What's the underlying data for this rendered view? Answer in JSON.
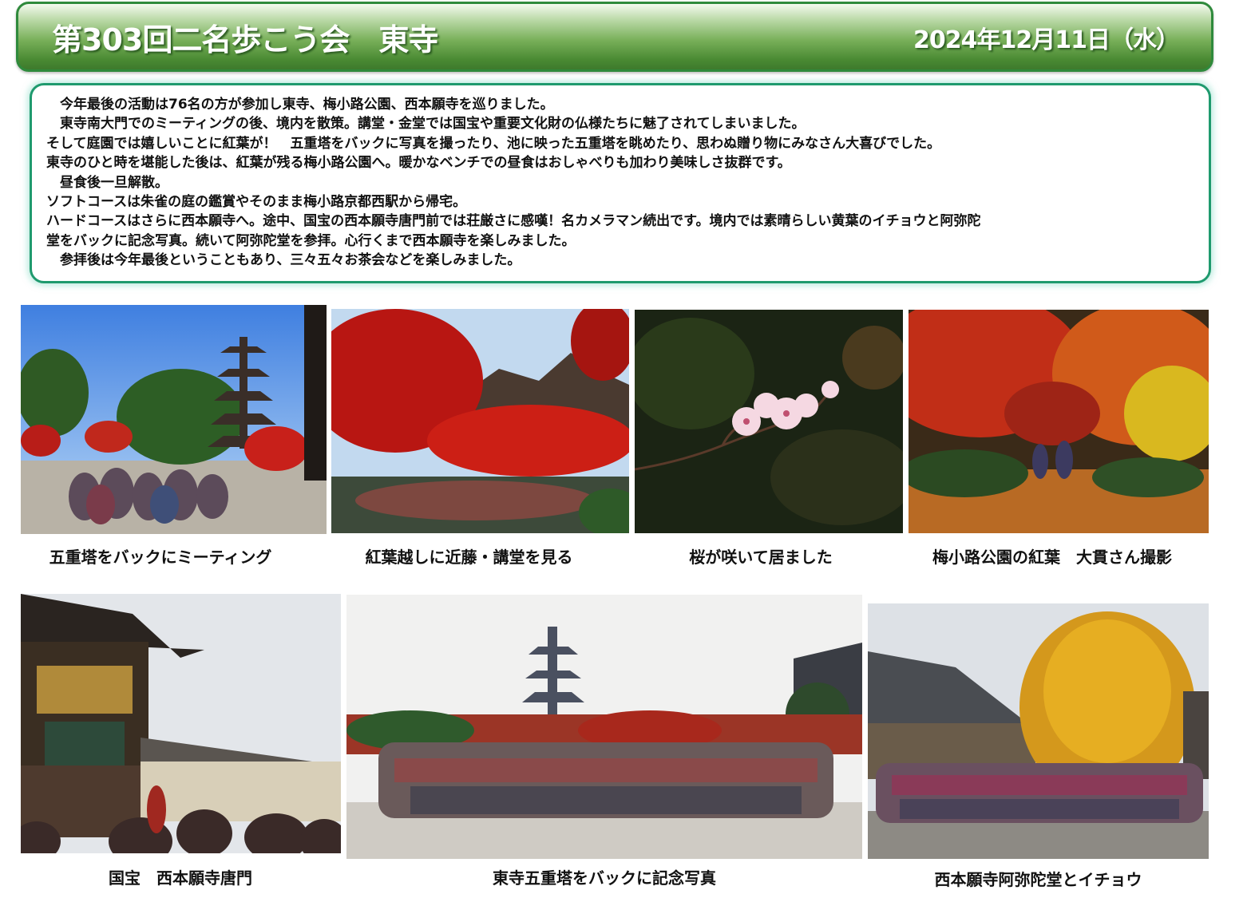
{
  "header": {
    "title": "第303回二名歩こう会　東寺",
    "date": "2024年12月11日（水）"
  },
  "report": {
    "lines": [
      "　今年最後の活動は76名の方が参加し東寺、梅小路公園、西本願寺を巡りました。",
      "　東寺南大門でのミーティングの後、境内を散策。講堂・金堂では国宝や重要文化財の仏様たちに魅了されてしまいました。",
      "そして庭園では嬉しいことに紅葉が！　五重塔をバックに写真を撮ったり、池に映った五重塔を眺めたり、思わぬ贈り物にみなさん大喜びでした。",
      "東寺のひと時を堪能した後は、紅葉が残る梅小路公園へ。暖かなベンチでの昼食はおしゃべりも加わり美味しさ抜群です。",
      "　昼食後一旦解散。",
      "ソフトコースは朱雀の庭の鑑賞やそのまま梅小路京都西駅から帰宅。",
      "ハードコースはさらに西本願寺へ。途中、国宝の西本願寺唐門前では荘厳さに感嘆！名カメラマン続出です。境内では素晴らしい黄葉のイチョウと阿弥陀",
      "堂をバックに記念写真。続いて阿弥陀堂を参拝。心行くまで西本願寺を楽しみました。",
      "　参拝後は今年最後ということもあり、三々五々お茶会などを楽しみました。"
    ]
  },
  "photos": {
    "captions": [
      "五重塔をバックにミーティング",
      "紅葉越しに近藤・講堂を見る",
      "桜が咲いて居ました",
      "梅小路公園の紅葉　大貫さん撮影",
      "国宝　西本願寺唐門",
      "東寺五重塔をバックに記念写真",
      "西本願寺阿弥陀堂とイチョウ"
    ]
  }
}
